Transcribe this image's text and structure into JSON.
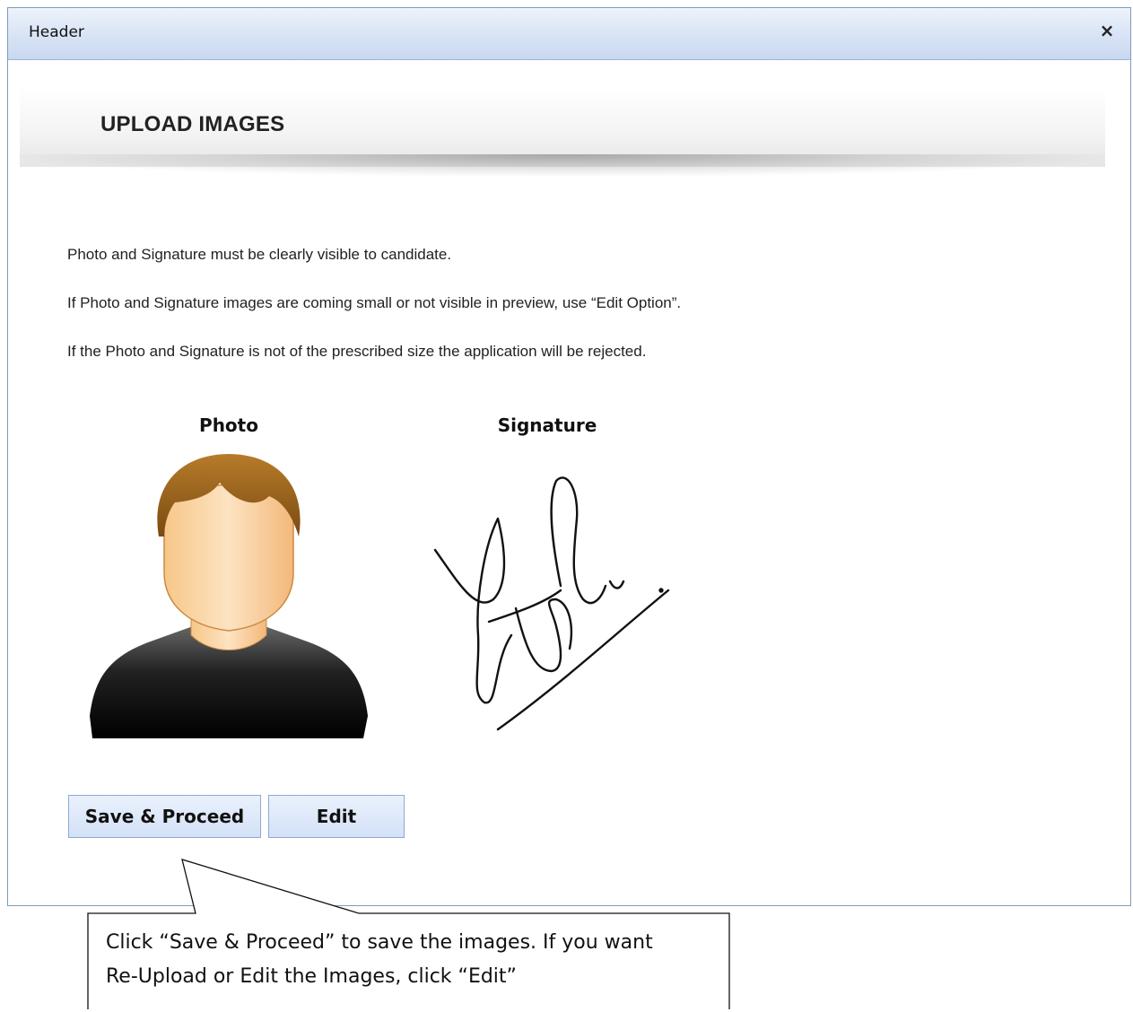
{
  "dialog": {
    "title": "Header",
    "close_glyph": "×"
  },
  "banner": {
    "title": "UPLOAD IMAGES"
  },
  "instructions": [
    "Photo and Signature must be clearly visible to candidate.",
    "If Photo and Signature images are coming small or not visible in preview, use “Edit Option”.",
    "If the Photo and Signature is not of the prescribed size the application will be rejected."
  ],
  "images": {
    "photo_label": "Photo",
    "signature_label": "Signature"
  },
  "buttons": {
    "save_label": "Save & Proceed",
    "edit_label": "Edit"
  },
  "callout": {
    "line1": "Click “Save & Proceed” to save the images. If you want",
    "line2": "Re-Upload or Edit the Images, click “Edit”"
  },
  "icons": {
    "photo": "user-avatar-icon",
    "signature": "signature-image",
    "close": "close-icon"
  }
}
